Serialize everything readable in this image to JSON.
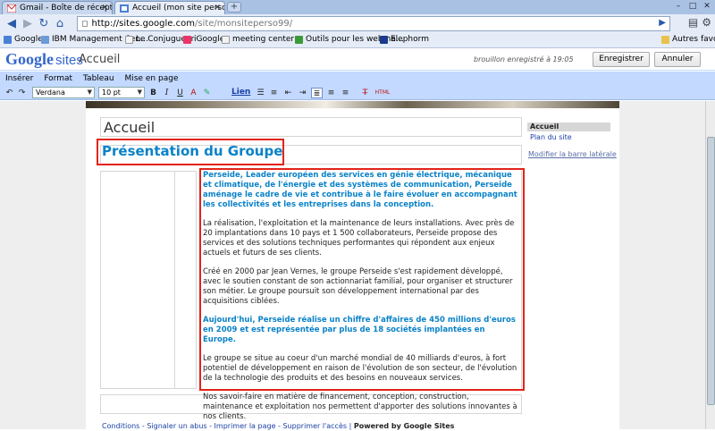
{
  "browser": {
    "tabs": [
      {
        "label": "Gmail - Boîte de réception (…",
        "active": false
      },
      {
        "label": "Accueil (mon site perso ave…",
        "active": true
      }
    ],
    "new_tab": "+",
    "url": {
      "host": "http://sites.google.com",
      "path": "/site/monsiteperso99/"
    },
    "bookmarks": [
      "Google",
      "IBM Management Cen…",
      "Le Conjugueur",
      "iGoogle",
      "meeting center",
      "Outils pour les webma…",
      "Elephorm"
    ],
    "other_bookmarks": "Autres favoris"
  },
  "sites_header": {
    "logo_google": "Google",
    "logo_sites": "sites",
    "page_name": "Accueil",
    "draft_status": "brouillon enregistré à 19:05",
    "save_label": "Enregistrer",
    "cancel_label": "Annuler"
  },
  "menu": [
    "Insérer",
    "Format",
    "Tableau",
    "Mise en page"
  ],
  "format_toolbar": {
    "font": "Verdana",
    "size": "10 pt",
    "link_label": "Lien",
    "html_label": "HTML"
  },
  "page": {
    "title": "Accueil",
    "heading": "Présentation du Groupe",
    "paragraphs": [
      {
        "style": "blue",
        "text": "Perseide, Leader européen des services en génie électrique, mécanique et climatique, de l'énergie et des systèmes de communication, Perseide aménage le cadre de vie et contribue à le faire évoluer en accompagnant les collectivités et les entreprises dans la conception."
      },
      {
        "style": "normal",
        "text": "La réalisation, l'exploitation et la maintenance de leurs installations. Avec près de 20 implantations dans 10 pays et 1 500 collaborateurs, Perseide propose des services et des solutions techniques performantes qui répondent aux enjeux actuels et futurs de ses clients."
      },
      {
        "style": "normal",
        "text": "Créé en 2000 par Jean Vernes, le groupe Perseide s'est rapidement développé, avec le soutien constant de son actionnariat familial, pour organiser et structurer son métier. Le groupe poursuit son développement international par des acquisitions ciblées."
      },
      {
        "style": "blue",
        "text": "Aujourd'hui, Perseide réalise un chiffre d'affaires de 450 millions d'euros en 2009 et est représentée par plus de 18 sociétés implantées en Europe."
      },
      {
        "style": "normal",
        "text": "Le groupe se situe au coeur d'un marché mondial de 40 milliards d'euros, à fort potentiel de développement en raison de l'évolution de son secteur, de l'évolution de la technologie des produits et des besoins en nouveaux services."
      },
      {
        "style": "normal",
        "text": "Nos savoir-faire en matière de financement, conception, construction, maintenance et exploitation nos permettent d'apporter des solutions innovantes à nos clients."
      }
    ]
  },
  "sidebar": {
    "header": "Accueil",
    "link_sitemap": "Plan du site",
    "link_modify": "Modifier la barre latérale"
  },
  "footer": {
    "links": [
      "Conditions",
      "Signaler un abus",
      "Imprimer la page",
      "Supprimer l'accès"
    ],
    "powered": "Powered by",
    "brand": "Google Sites"
  },
  "colors": {
    "accent_blue": "#0a82c8",
    "highlight_red": "#e2231a",
    "editor_bar": "#c3d9ff"
  }
}
